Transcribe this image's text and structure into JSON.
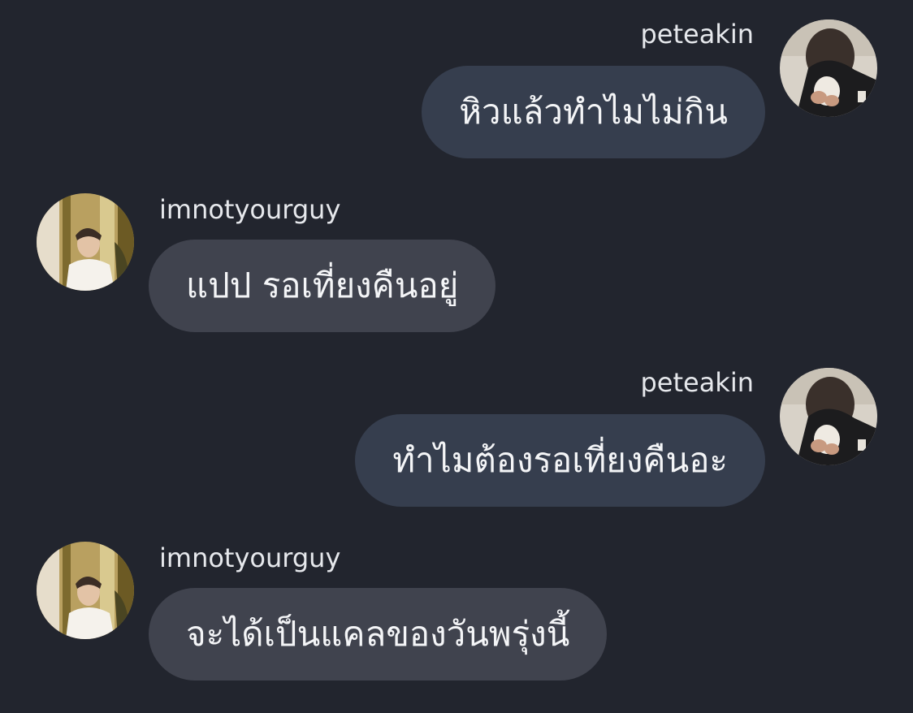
{
  "conversation": {
    "messages": [
      {
        "sender": "peteakin",
        "text": "หิวแล้วทำไมไม่กิน",
        "direction": "outgoing"
      },
      {
        "sender": "imnotyourguy",
        "text": "แปป รอเที่ยงคืนอยู่",
        "direction": "incoming"
      },
      {
        "sender": "peteakin",
        "text": "ทำไมต้องรอเที่ยงคืนอะ",
        "direction": "outgoing"
      },
      {
        "sender": "imnotyourguy",
        "text": "จะได้เป็นแคลของวันพรุ่งนี้",
        "direction": "incoming"
      }
    ]
  },
  "colors": {
    "background": "#22252e",
    "outgoing_bubble": "#363e4e",
    "incoming_bubble": "#40434e",
    "text": "#f4f5f7"
  }
}
